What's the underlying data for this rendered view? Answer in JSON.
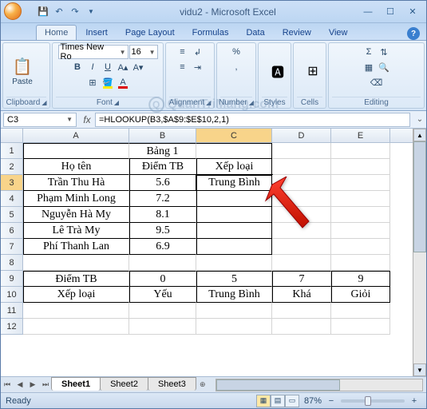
{
  "app": {
    "title": "vidu2 - Microsoft Excel"
  },
  "qat": {
    "save": "save",
    "undo": "undo",
    "redo": "redo"
  },
  "tabs": [
    "Home",
    "Insert",
    "Page Layout",
    "Formulas",
    "Data",
    "Review",
    "View"
  ],
  "ribbon": {
    "clipboard": {
      "label": "Clipboard",
      "paste": "Paste"
    },
    "font": {
      "label": "Font",
      "name": "Times New Ro",
      "size": "16",
      "bold": "B",
      "italic": "I",
      "underline": "U"
    },
    "alignment": {
      "label": "Alignment"
    },
    "number": {
      "label": "Number",
      "pct": "%"
    },
    "styles": {
      "label": "Styles"
    },
    "cells": {
      "label": "Cells"
    },
    "editing": {
      "label": "Editing",
      "sigma": "Σ"
    }
  },
  "namebox": "C3",
  "formula": "=HLOOKUP(B3,$A$9:$E$10,2,1)",
  "cols": [
    "A",
    "B",
    "C",
    "D",
    "E"
  ],
  "rows": [
    "1",
    "2",
    "3",
    "4",
    "5",
    "6",
    "7",
    "8",
    "9",
    "10",
    "11",
    "12"
  ],
  "cells": {
    "B1": "Bảng 1",
    "A2": "Họ tên",
    "B2": "Điểm TB",
    "C2": "Xếp loại",
    "A3": "Trần Thu Hà",
    "B3": "5.6",
    "C3": "Trung Bình",
    "A4": "Phạm Minh Long",
    "B4": "7.2",
    "A5": "Nguyễn Hà My",
    "B5": "8.1",
    "A6": "Lê Trà My",
    "B6": "9.5",
    "A7": "Phí Thanh Lan",
    "B7": "6.9",
    "A9": "Điểm TB",
    "B9": "0",
    "C9": "5",
    "D9": "7",
    "E9": "9",
    "A10": "Xếp loại",
    "B10": "Yếu",
    "C10": "Trung Bình",
    "D10": "Khá",
    "E10": "Giỏi"
  },
  "sheets": [
    "Sheet1",
    "Sheet2",
    "Sheet3"
  ],
  "status": {
    "ready": "Ready",
    "zoom": "87%"
  },
  "watermark": "QuanTriMang.com"
}
